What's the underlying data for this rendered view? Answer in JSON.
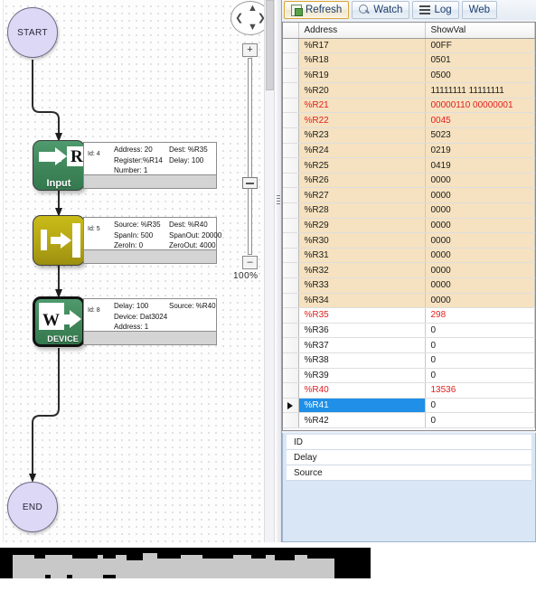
{
  "canvas": {
    "zoom_level": "100%",
    "pan_compass": {
      "up": "▲",
      "down": "▼",
      "left": "❮",
      "right": "❯"
    },
    "zoom_in_label": "+",
    "zoom_out_label": "–",
    "nodes": {
      "start": {
        "label": "START"
      },
      "end": {
        "label": "END"
      },
      "input": {
        "icon_letter": "R",
        "label": "Input",
        "id_label": "Id: 4",
        "col1": [
          "Address: 20",
          "Register:%R14",
          "Number: 1"
        ],
        "col2": [
          "Dest: %R35",
          "Delay: 100"
        ]
      },
      "scale": {
        "label": "",
        "id_label": "Id: 5",
        "col1": [
          "Source: %R35",
          "SpanIn: 500",
          "ZeroIn: 0"
        ],
        "col2": [
          "Dest: %R40",
          "SpanOut: 20000",
          "ZeroOut: 4000"
        ]
      },
      "write_device": {
        "icon_letter": "W",
        "label": "DEVICE",
        "id_label": "Id: 8",
        "col1": [
          "Delay: 100",
          "Device: Dat3024",
          "Address: 1"
        ],
        "col2": [
          "Source: %R40"
        ]
      }
    }
  },
  "toolbar": {
    "refresh_label": "Refresh",
    "watch_label": "Watch",
    "log_label": "Log",
    "web_label": "Web"
  },
  "grid": {
    "headers": {
      "indicator": "",
      "address": "Address",
      "showval": "ShowVal"
    },
    "rows": [
      {
        "address": "%R17",
        "showval": "00FF",
        "band": "tan",
        "red": false,
        "selected": false
      },
      {
        "address": "%R18",
        "showval": "0501",
        "band": "tan",
        "red": false,
        "selected": false
      },
      {
        "address": "%R19",
        "showval": "0500",
        "band": "tan",
        "red": false,
        "selected": false
      },
      {
        "address": "%R20",
        "showval": "11111111 11111111",
        "band": "tan",
        "red": false,
        "selected": false
      },
      {
        "address": "%R21",
        "showval": "00000110 00000001",
        "band": "tan",
        "red": true,
        "selected": false
      },
      {
        "address": "%R22",
        "showval": "0045",
        "band": "tan",
        "red": true,
        "selected": false
      },
      {
        "address": "%R23",
        "showval": "5023",
        "band": "tan",
        "red": false,
        "selected": false
      },
      {
        "address": "%R24",
        "showval": "0219",
        "band": "tan",
        "red": false,
        "selected": false
      },
      {
        "address": "%R25",
        "showval": "0419",
        "band": "tan",
        "red": false,
        "selected": false
      },
      {
        "address": "%R26",
        "showval": "0000",
        "band": "tan",
        "red": false,
        "selected": false
      },
      {
        "address": "%R27",
        "showval": "0000",
        "band": "tan",
        "red": false,
        "selected": false
      },
      {
        "address": "%R28",
        "showval": "0000",
        "band": "tan",
        "red": false,
        "selected": false
      },
      {
        "address": "%R29",
        "showval": "0000",
        "band": "tan",
        "red": false,
        "selected": false
      },
      {
        "address": "%R30",
        "showval": "0000",
        "band": "tan",
        "red": false,
        "selected": false
      },
      {
        "address": "%R31",
        "showval": "0000",
        "band": "tan",
        "red": false,
        "selected": false
      },
      {
        "address": "%R32",
        "showval": "0000",
        "band": "tan",
        "red": false,
        "selected": false
      },
      {
        "address": "%R33",
        "showval": "0000",
        "band": "tan",
        "red": false,
        "selected": false
      },
      {
        "address": "%R34",
        "showval": "0000",
        "band": "tan",
        "red": false,
        "selected": false
      },
      {
        "address": "%R35",
        "showval": "298",
        "band": "plain",
        "red": true,
        "selected": false
      },
      {
        "address": "%R36",
        "showval": "0",
        "band": "plain",
        "red": false,
        "selected": false
      },
      {
        "address": "%R37",
        "showval": "0",
        "band": "plain",
        "red": false,
        "selected": false
      },
      {
        "address": "%R38",
        "showval": "0",
        "band": "plain",
        "red": false,
        "selected": false
      },
      {
        "address": "%R39",
        "showval": "0",
        "band": "plain",
        "red": false,
        "selected": false
      },
      {
        "address": "%R40",
        "showval": "13536",
        "band": "plain",
        "red": true,
        "selected": false
      },
      {
        "address": "%R41",
        "showval": "0",
        "band": "plain",
        "red": false,
        "selected": true
      },
      {
        "address": "%R42",
        "showval": "0",
        "band": "plain",
        "red": false,
        "selected": false
      }
    ]
  },
  "properties": {
    "rows": [
      "ID",
      "Delay",
      "Source"
    ]
  },
  "colors": {
    "selection_blue": "#1f8fe8",
    "alert_red": "#e02020",
    "band_tan": "#f6e2c0",
    "node_green": "#3e8659",
    "node_olive": "#b5a614",
    "terminator_lavender": "#ddd8f5"
  }
}
